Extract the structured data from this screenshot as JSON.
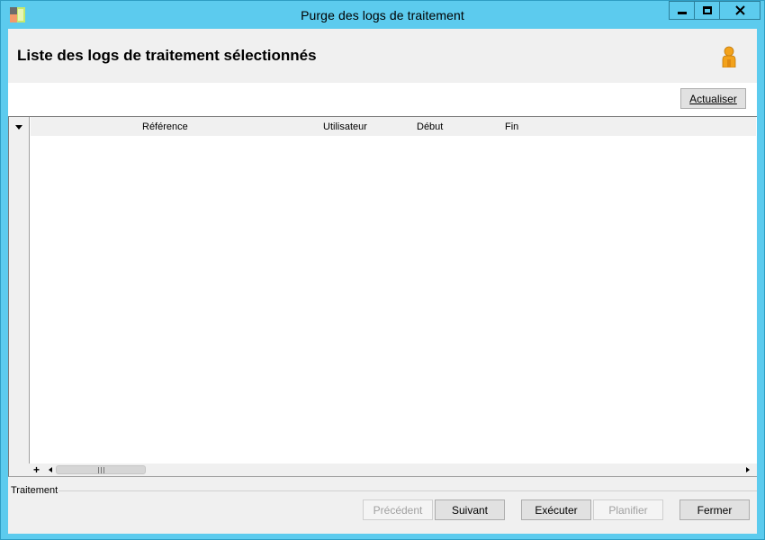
{
  "window": {
    "title": "Purge des logs de traitement",
    "app_icon": "app-multicolor-icon",
    "controls": [
      "minimize",
      "maximize",
      "close"
    ]
  },
  "header": {
    "title": "Liste des logs de traitement sélectionnés",
    "user_icon": "user-person-icon"
  },
  "toolbar": {
    "refresh_label": "Actualiser",
    "refresh_accesskey": "A"
  },
  "grid": {
    "columns": [
      {
        "label": "Référence"
      },
      {
        "label": "Utilisateur"
      },
      {
        "label": "Début"
      },
      {
        "label": "Fin"
      }
    ],
    "rows": [],
    "add_row_label": "+"
  },
  "group": {
    "label": "Traitement"
  },
  "footer": {
    "previous_label": "Précédent",
    "next_label": "Suivant",
    "execute_label": "Exécuter",
    "schedule_label": "Planifier",
    "close_label": "Fermer",
    "previous_enabled": false,
    "schedule_enabled": false
  },
  "colors": {
    "title_bar": "#5ccbee",
    "client_background": "#f0f0f0",
    "button_face": "#e1e1e1"
  }
}
